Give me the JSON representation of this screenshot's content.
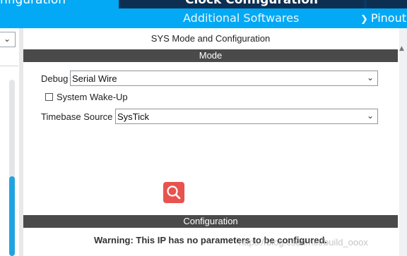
{
  "tabs": {
    "pinout_config": "nfiguration",
    "clock_config": "Clock Configuration"
  },
  "toolbar": {
    "additional_softwares": "Additional Softwares",
    "pinout": "Pinout"
  },
  "panel": {
    "title": "SYS Mode and Configuration",
    "mode_header": "Mode",
    "debug": {
      "label": "Debug",
      "value": "Serial Wire"
    },
    "wakeup": {
      "label": "System Wake-Up",
      "checked": false
    },
    "timebase": {
      "label": "Timebase Source",
      "value": "SysTick"
    },
    "config_header": "Configuration",
    "warning": "Warning: This IP has no parameters to be configured."
  },
  "watermark": "https://blog.csdn.net/build_ooox",
  "colors": {
    "accent": "#03a9f4",
    "dark_tab": "#0d2f52",
    "section_bar": "#4a4a4a",
    "zoom_button": "#e8534f"
  },
  "icons": {
    "dropdown": "chevron-down-icon",
    "zoom": "zoom-search-icon"
  }
}
